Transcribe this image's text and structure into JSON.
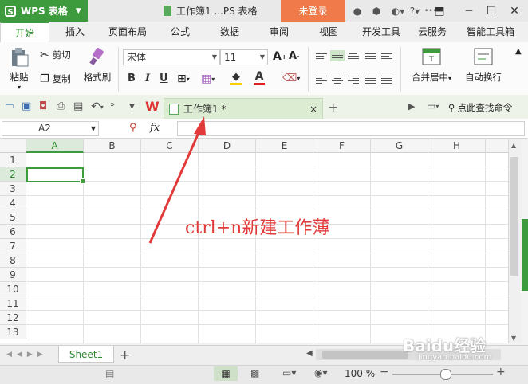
{
  "titlebar": {
    "app_name": "WPS 表格",
    "app_logo": "S",
    "doc_title": "工作簿1 ...PS 表格",
    "login_label": "未登录"
  },
  "tabs": [
    "开始",
    "插入",
    "页面布局",
    "公式",
    "数据",
    "审阅",
    "视图",
    "开发工具",
    "云服务",
    "智能工具箱"
  ],
  "ribbon": {
    "paste": "粘贴",
    "cut": "剪切",
    "copy": "复制",
    "format_painter": "格式刷",
    "font_name": "宋体",
    "font_size": "11",
    "bold": "B",
    "italic": "I",
    "underline": "U",
    "font_color": "A",
    "merge_center": "合并居中",
    "wrap_text": "自动换行"
  },
  "doc_tab": {
    "label": "工作簿1 *",
    "close": "×",
    "add": "+",
    "search": "点此查找命令"
  },
  "formula_bar": {
    "cell_ref": "A2",
    "fx": "fx"
  },
  "columns": [
    "A",
    "B",
    "C",
    "D",
    "E",
    "F",
    "G",
    "H"
  ],
  "rows": [
    "1",
    "2",
    "3",
    "4",
    "5",
    "6",
    "7",
    "8",
    "9",
    "10",
    "11",
    "12",
    "13"
  ],
  "sheet_tabs": {
    "active": "Sheet1",
    "add": "+"
  },
  "status_bar": {
    "zoom": "100 %",
    "zoom_minus": "−",
    "zoom_plus": "+"
  },
  "annotation": "ctrl+n新建工作薄",
  "watermark": "Baidu经验",
  "watermark_url": "jingyan.baidu.com",
  "colors": {
    "accent": "#3d9a3d",
    "login": "#f07a4a",
    "annotation": "#e23a3a"
  }
}
